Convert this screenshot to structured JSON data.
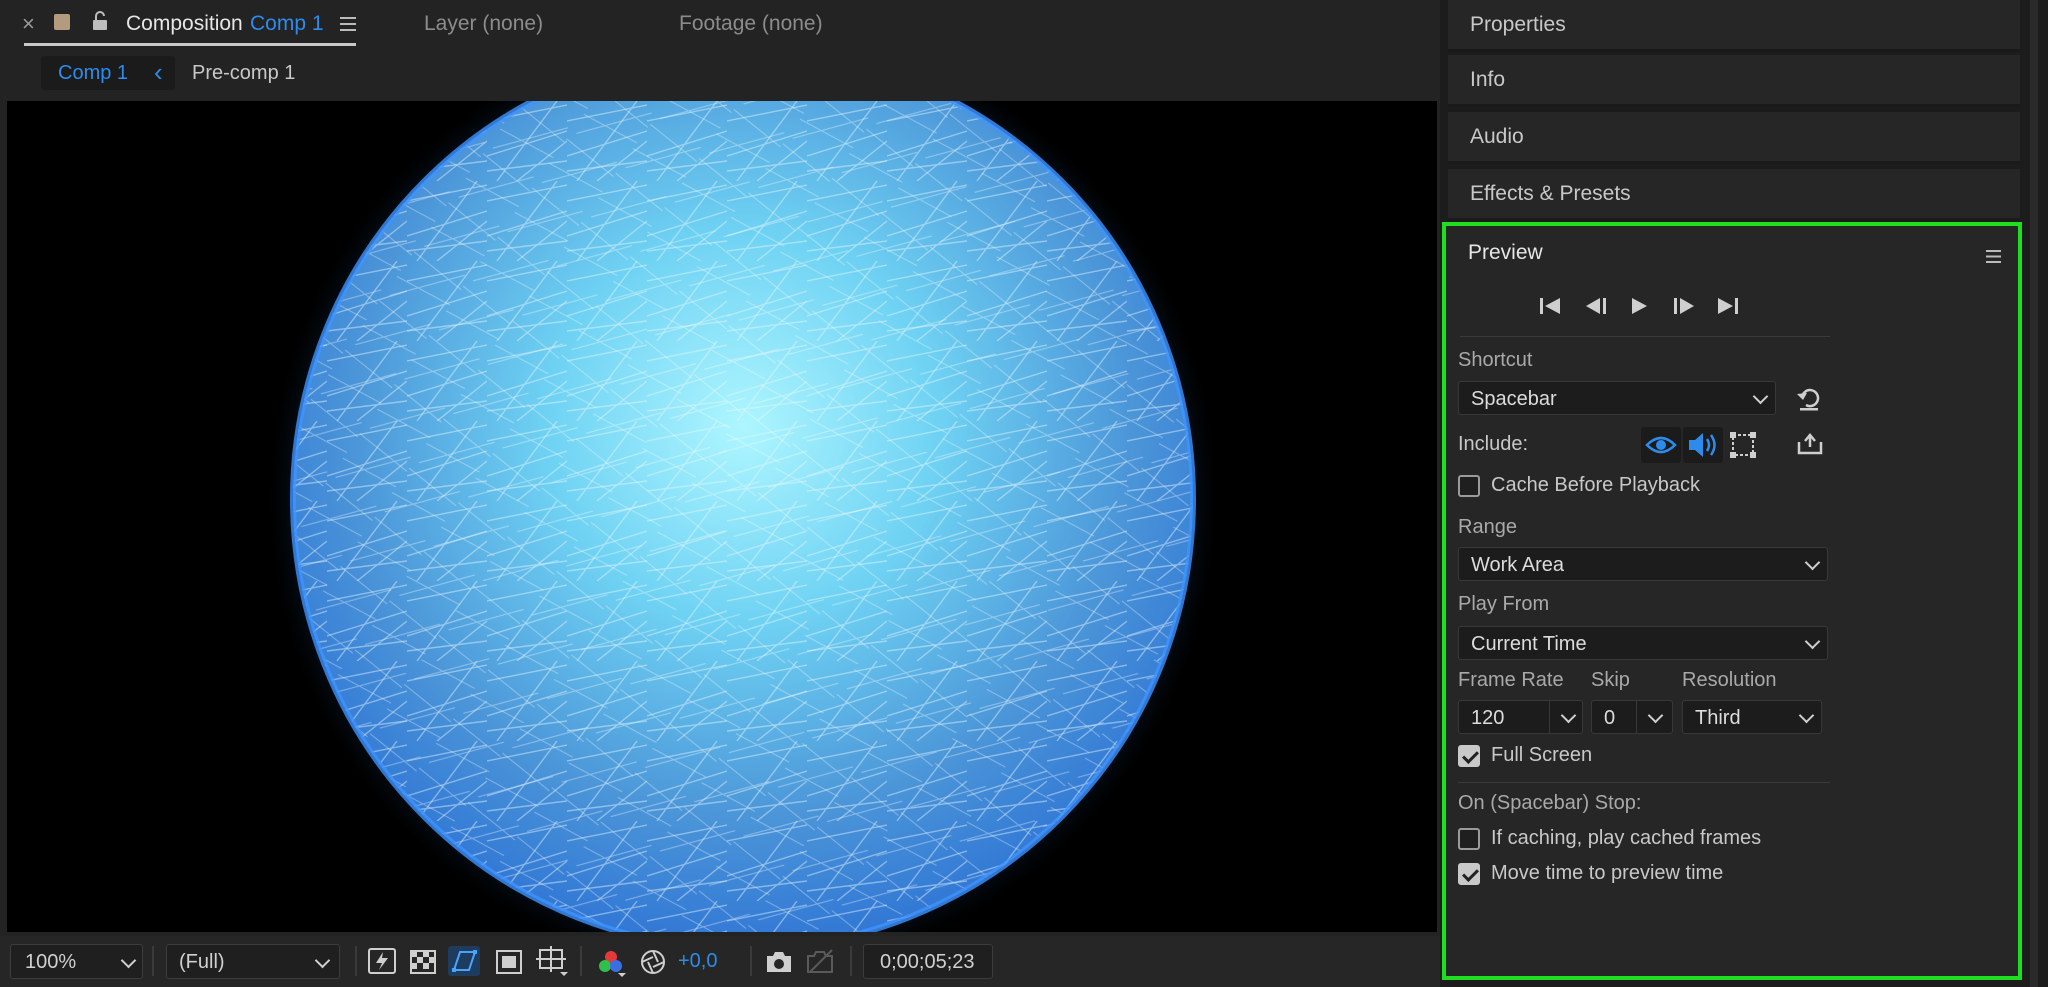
{
  "composition_panel": {
    "tabs": {
      "close_glyph": "×",
      "composition_label": "Composition",
      "composition_name": "Comp 1",
      "layer": "Layer (none)",
      "footage": "Footage (none)"
    },
    "breadcrumb": {
      "current": "Comp 1",
      "back_glyph": "‹",
      "parent": "Pre-comp 1"
    },
    "bottom_toolbar": {
      "zoom": "100%",
      "resolution": "(Full)",
      "exposure": "+0,0",
      "timecode": "0;00;05;23"
    }
  },
  "right_panels": {
    "collapsed": [
      "Properties",
      "Info",
      "Audio",
      "Effects & Presets"
    ],
    "preview": {
      "title": "Preview",
      "shortcut_label": "Shortcut",
      "shortcut_value": "Spacebar",
      "include_label": "Include:",
      "cache_before_playback": {
        "label": "Cache Before Playback",
        "checked": false
      },
      "range_label": "Range",
      "range_value": "Work Area",
      "play_from_label": "Play From",
      "play_from_value": "Current Time",
      "frame_rate_label": "Frame Rate",
      "frame_rate_value": "120",
      "skip_label": "Skip",
      "skip_value": "0",
      "resolution_label": "Resolution",
      "resolution_value": "Third",
      "full_screen": {
        "label": "Full Screen",
        "checked": true
      },
      "stop_label": "On (Spacebar) Stop:",
      "if_caching": {
        "label": "If caching, play cached frames",
        "checked": false
      },
      "move_time": {
        "label": "Move time to preview time",
        "checked": true
      }
    }
  },
  "colors": {
    "accent_blue": "#2d8ceb",
    "highlight_green": "#1fdd1f",
    "panel_bg": "#262626"
  },
  "icons": [
    "close-icon",
    "label-color-swatch",
    "lock-icon",
    "panel-menu-icon",
    "first-frame-icon",
    "previous-frame-icon",
    "play-icon",
    "next-frame-icon",
    "last-frame-icon",
    "reset-icon",
    "video-eye-icon",
    "audio-speaker-icon",
    "overlays-icon",
    "export-icon",
    "snapshot-icon"
  ]
}
